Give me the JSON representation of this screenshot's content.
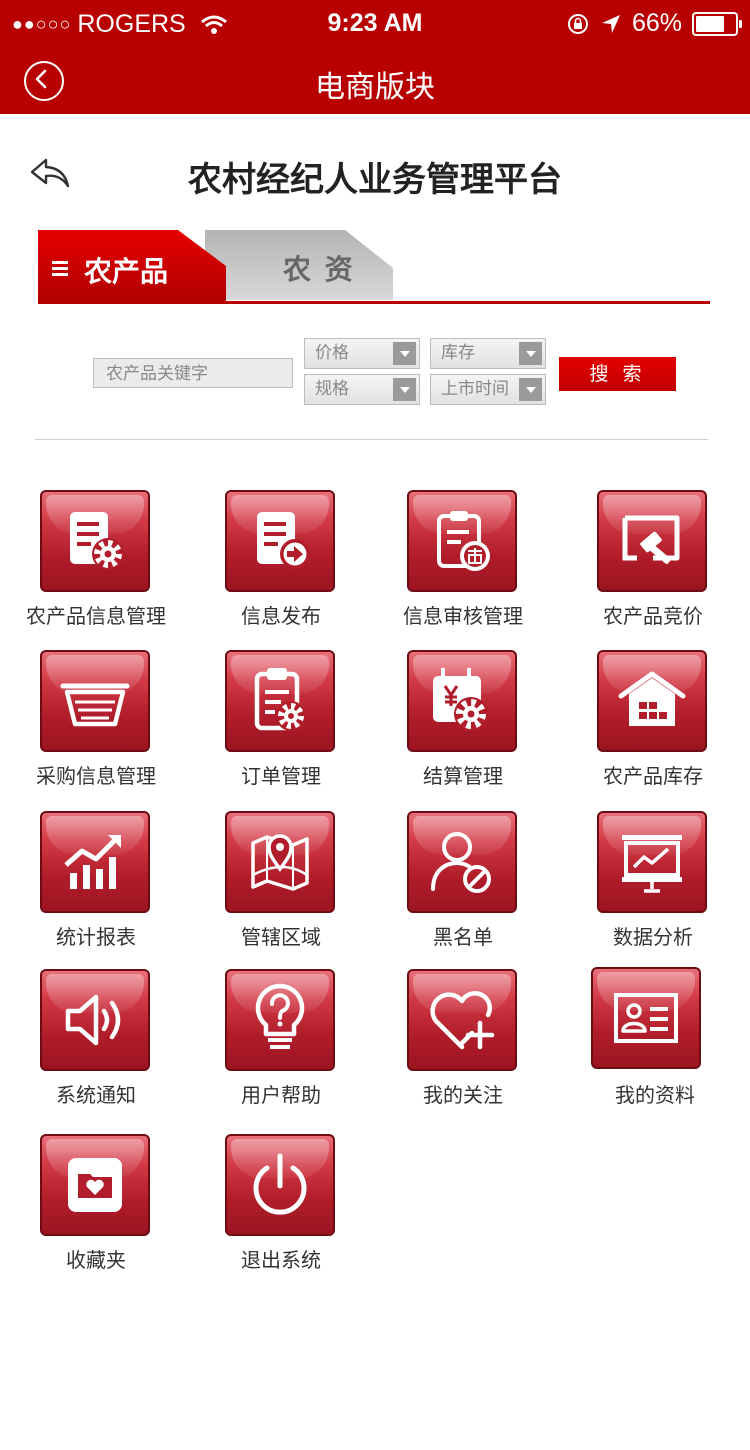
{
  "status": {
    "carrier": "ROGERS",
    "time": "9:23 AM",
    "battery": "66%"
  },
  "nav": {
    "title": "电商版块"
  },
  "header": {
    "title": "农村经纪人业务管理平台"
  },
  "tabs": [
    {
      "label": "农产品",
      "active": true
    },
    {
      "label": "农 资",
      "active": false
    }
  ],
  "search": {
    "placeholder": "农产品关键字",
    "selects": {
      "price": "价格",
      "stock": "库存",
      "spec": "规格",
      "date": "上市时间"
    },
    "button": "搜 索"
  },
  "colors": {
    "brand": "#b80000",
    "tile": "#b11d2a"
  },
  "menu": [
    {
      "label": "农产品信息管理",
      "icon": "doc-gear-icon"
    },
    {
      "label": "信息发布",
      "icon": "doc-arrow-icon"
    },
    {
      "label": "信息审核管理",
      "icon": "clipboard-audit-icon"
    },
    {
      "label": "农产品竞价",
      "icon": "auction-hammer-icon"
    },
    {
      "label": "采购信息管理",
      "icon": "basket-icon"
    },
    {
      "label": "订单管理",
      "icon": "clipboard-gear-icon"
    },
    {
      "label": "结算管理",
      "icon": "calendar-yen-icon"
    },
    {
      "label": "农产品库存",
      "icon": "warehouse-icon"
    },
    {
      "label": "统计报表",
      "icon": "bar-chart-icon"
    },
    {
      "label": "管辖区域",
      "icon": "map-pin-icon"
    },
    {
      "label": "黑名单",
      "icon": "user-blocked-icon"
    },
    {
      "label": "数据分析",
      "icon": "presentation-icon"
    },
    {
      "label": "系统通知",
      "icon": "speaker-icon"
    },
    {
      "label": "用户帮助",
      "icon": "help-bulb-icon"
    },
    {
      "label": "我的关注",
      "icon": "heart-plus-icon"
    },
    {
      "label": "我的资料",
      "icon": "id-card-icon"
    },
    {
      "label": "收藏夹",
      "icon": "folder-heart-icon"
    },
    {
      "label": "退出系统",
      "icon": "power-icon"
    }
  ]
}
